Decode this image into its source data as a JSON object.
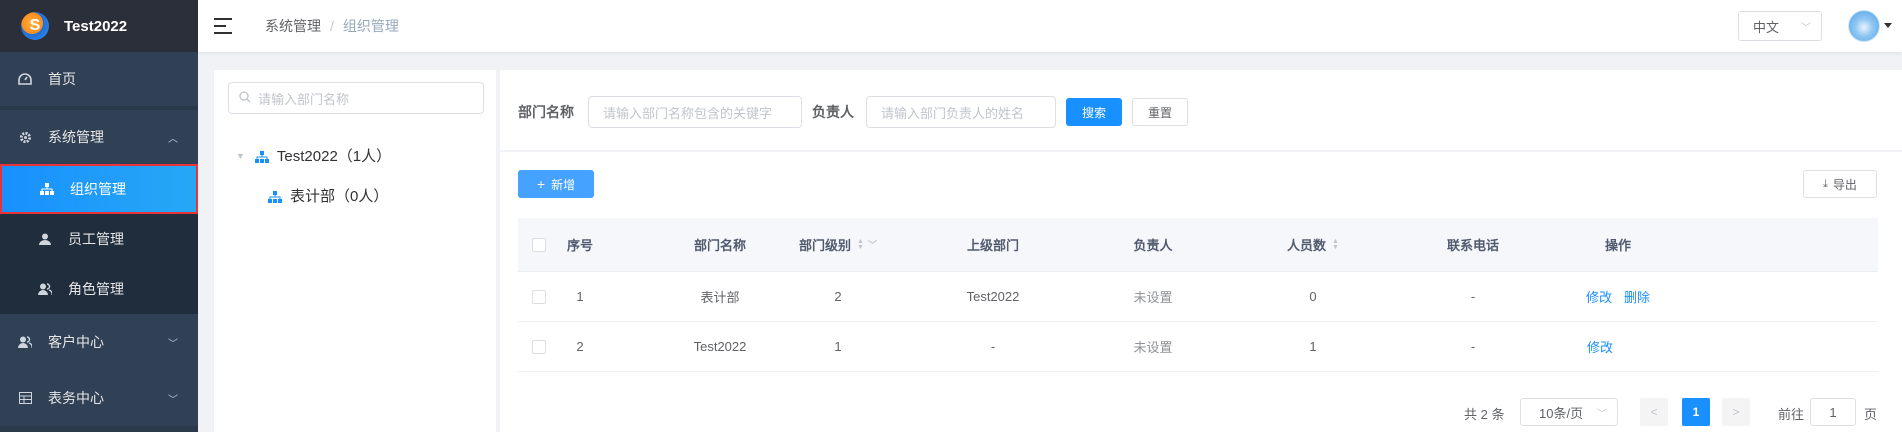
{
  "app": {
    "title": "Test2022"
  },
  "sidebar": {
    "home": "首页",
    "system": "系统管理",
    "org": "组织管理",
    "staff": "员工管理",
    "role": "角色管理",
    "customer": "客户中心",
    "meter": "表务中心"
  },
  "header": {
    "breadcrumb": [
      "系统管理",
      "组织管理"
    ],
    "breadcrumb_sep": "/",
    "language": "中文"
  },
  "tree": {
    "search_placeholder": "请输入部门名称",
    "nodes": [
      {
        "label": "Test2022（1人）"
      },
      {
        "label": "表计部（0人）"
      }
    ]
  },
  "filter": {
    "dept_label": "部门名称",
    "dept_placeholder": "请输入部门名称包含的关键字",
    "owner_label": "负责人",
    "owner_placeholder": "请输入部门负责人的姓名",
    "search_btn": "搜索",
    "reset_btn": "重置"
  },
  "toolbar": {
    "add_btn": "新增",
    "export_btn": "导出"
  },
  "table": {
    "columns": [
      "序号",
      "部门名称",
      "部门级别",
      "上级部门",
      "负责人",
      "人员数",
      "联系电话",
      "操作"
    ],
    "rows": [
      {
        "index": "1",
        "name": "表计部",
        "level": "2",
        "parent": "Test2022",
        "owner": "未设置",
        "count": "0",
        "phone": "-",
        "actions": [
          "修改",
          "删除"
        ]
      },
      {
        "index": "2",
        "name": "Test2022",
        "level": "1",
        "parent": "-",
        "owner": "未设置",
        "count": "1",
        "phone": "-",
        "actions": [
          "修改"
        ]
      }
    ]
  },
  "pagination": {
    "total": "共 2 条",
    "page_size": "10条/页",
    "current_page": "1",
    "goto_label": "前往",
    "goto_value": "1",
    "page_suffix": "页"
  },
  "colors": {
    "primary": "#1890ff",
    "sidebar_bg": "#2b3a4b",
    "active_border": "#e8333a"
  }
}
